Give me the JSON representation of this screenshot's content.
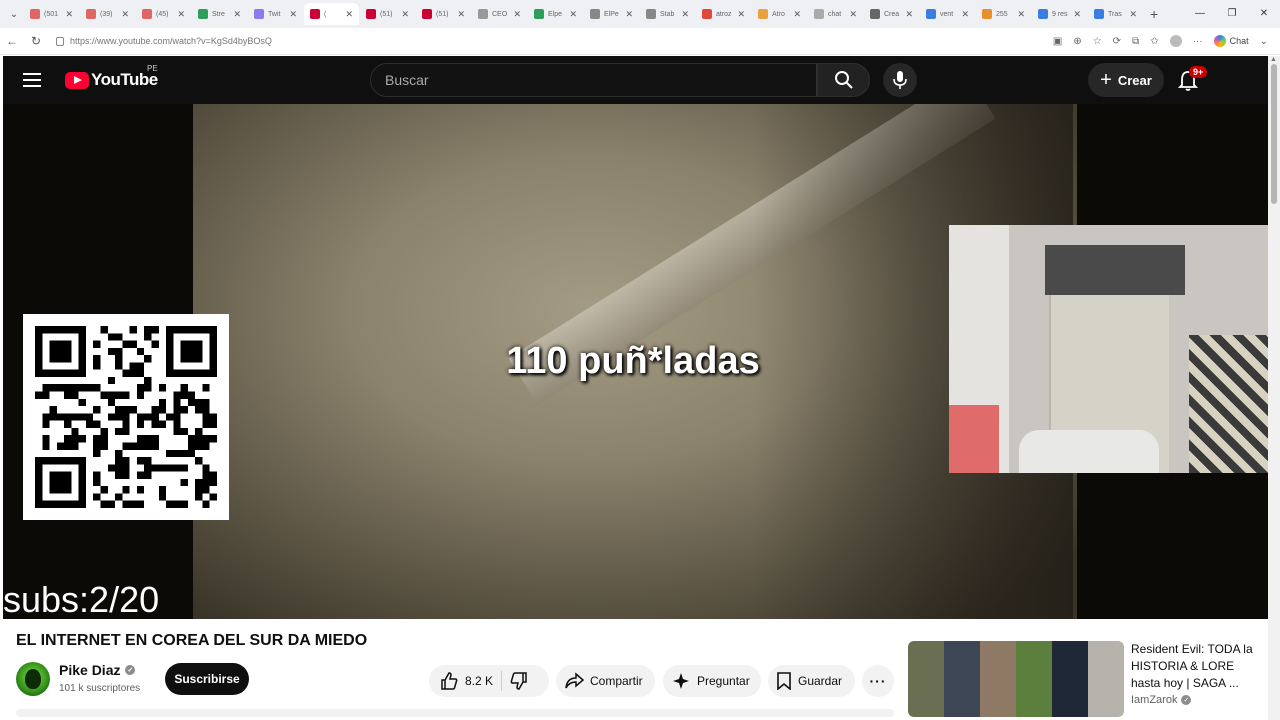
{
  "browser": {
    "tabs": [
      {
        "label": "(501",
        "color": "#e06666"
      },
      {
        "label": "(39)",
        "color": "#e06666"
      },
      {
        "label": "(45)",
        "color": "#e06666"
      },
      {
        "label": "Stre",
        "color": "#2e9e5b"
      },
      {
        "label": "Twit",
        "color": "#8a7cf0"
      },
      {
        "label": "(",
        "color": "#cc0033",
        "active": true
      },
      {
        "label": "(51)",
        "color": "#cc0033"
      },
      {
        "label": "(51)",
        "color": "#cc0033"
      },
      {
        "label": "CEO",
        "color": "#999999"
      },
      {
        "label": "Elpe",
        "color": "#2e9e5b"
      },
      {
        "label": "ElPe",
        "color": "#888888"
      },
      {
        "label": "Stab",
        "color": "#888888"
      },
      {
        "label": "atroz",
        "color": "#e0483b"
      },
      {
        "label": "Atro",
        "color": "#e8a040"
      },
      {
        "label": "chat",
        "color": "#aaaaaa"
      },
      {
        "label": "Crea",
        "color": "#666666"
      },
      {
        "label": "vent",
        "color": "#3b7de0"
      },
      {
        "label": "255",
        "color": "#e8902f"
      },
      {
        "label": "9 res",
        "color": "#3b7de0"
      },
      {
        "label": "Tras",
        "color": "#3b7de0"
      }
    ],
    "url": "https://www.youtube.com/watch?v=KgSd4byBOsQ",
    "copilot_label": "Chat"
  },
  "youtube": {
    "logo_text": "YouTube",
    "country_code": "PE",
    "search_placeholder": "Buscar",
    "create_label": "Crear",
    "notif_badge": "9+"
  },
  "video": {
    "overlay_text": "110 puñ*ladas",
    "subs_counter": "subs:2/20"
  },
  "meta": {
    "title": "EL INTERNET EN COREA DEL SUR DA MIEDO",
    "channel_name": "Pike Diaz",
    "channel_subs": "101 k suscriptores",
    "subscribe_label": "Suscribirse",
    "likes": "8.2 K",
    "share_label": "Compartir",
    "ask_label": "Preguntar",
    "save_label": "Guardar"
  },
  "recommendation": {
    "title": "Resident Evil: TODA la HISTORIA & LORE hasta hoy | SAGA ...",
    "channel": "IamZarok"
  }
}
